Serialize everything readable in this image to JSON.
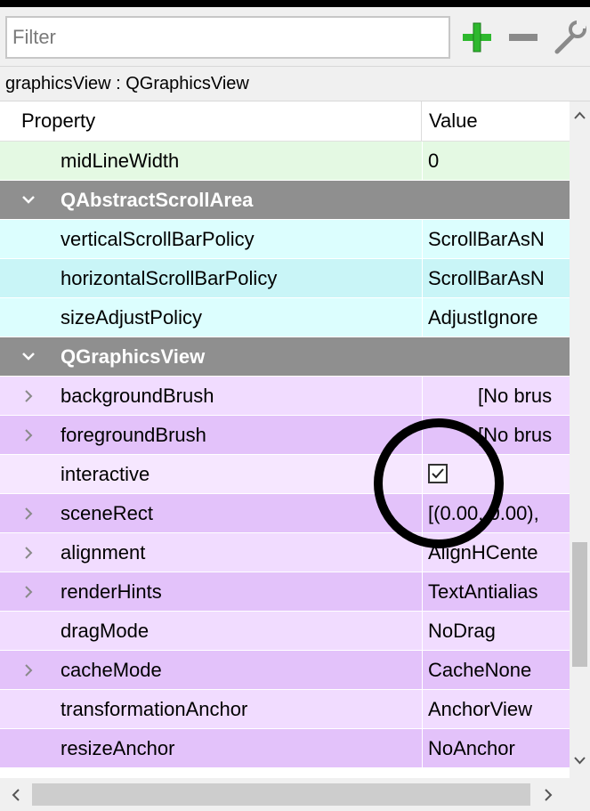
{
  "filter": {
    "placeholder": "Filter"
  },
  "toolbar": {
    "add_icon": "plus-icon",
    "remove_icon": "minus-icon",
    "config_icon": "wrench-icon",
    "add_color": "#2eb82e",
    "remove_color": "#7a7a7a"
  },
  "object_label": "graphicsView : QGraphicsView",
  "table": {
    "header": {
      "property": "Property",
      "value": "Value"
    },
    "rows": [
      {
        "prop": "midLineWidth",
        "value": "0",
        "style": "bg-green",
        "type": "prop",
        "expand": false
      },
      {
        "prop": "QAbstractScrollArea",
        "value": "",
        "style": "group",
        "type": "group",
        "expand": true
      },
      {
        "prop": "verticalScrollBarPolicy",
        "value": "ScrollBarAsN",
        "style": "bg-cyan-1",
        "type": "prop",
        "expand": false
      },
      {
        "prop": "horizontalScrollBarPolicy",
        "value": "ScrollBarAsN",
        "style": "bg-cyan-2",
        "type": "prop",
        "expand": false
      },
      {
        "prop": "sizeAdjustPolicy",
        "value": "AdjustIgnore",
        "style": "bg-cyan-1",
        "type": "prop",
        "expand": false
      },
      {
        "prop": "QGraphicsView",
        "value": "",
        "style": "group",
        "type": "group",
        "expand": true
      },
      {
        "prop": "backgroundBrush",
        "value": "[No brus",
        "style": "bg-pink-1",
        "type": "prop",
        "expand": true,
        "indent_value": true
      },
      {
        "prop": "foregroundBrush",
        "value": "[No brus",
        "style": "bg-pink-2",
        "type": "prop",
        "expand": true,
        "indent_value": true
      },
      {
        "prop": "interactive",
        "value": "",
        "style": "bg-pink-3",
        "type": "checkbox",
        "expand": false,
        "checked": true
      },
      {
        "prop": "sceneRect",
        "value": "[(0.00, 0.00),",
        "style": "bg-pink-2",
        "type": "prop",
        "expand": true
      },
      {
        "prop": "alignment",
        "value": "AlignHCente",
        "style": "bg-pink-1",
        "type": "prop",
        "expand": true
      },
      {
        "prop": "renderHints",
        "value": "TextAntialias",
        "style": "bg-pink-2",
        "type": "prop",
        "expand": true
      },
      {
        "prop": "dragMode",
        "value": "NoDrag",
        "style": "bg-pink-1",
        "type": "prop",
        "expand": false
      },
      {
        "prop": "cacheMode",
        "value": "CacheNone",
        "style": "bg-pink-2",
        "type": "prop",
        "expand": true
      },
      {
        "prop": "transformationAnchor",
        "value": "AnchorView",
        "style": "bg-pink-1",
        "type": "prop",
        "expand": false
      },
      {
        "prop": "resizeAnchor",
        "value": "NoAnchor",
        "style": "bg-pink-2",
        "type": "prop",
        "expand": false
      }
    ]
  },
  "scrollbars": {
    "vertical": {
      "position_fraction": 0.83,
      "visible_fraction": 0.2
    },
    "horizontal": {
      "position_fraction": 0.0,
      "visible_fraction": 0.95
    }
  },
  "annotation": {
    "shape": "circle",
    "color": "#000000",
    "target": "interactive-checkbox"
  }
}
